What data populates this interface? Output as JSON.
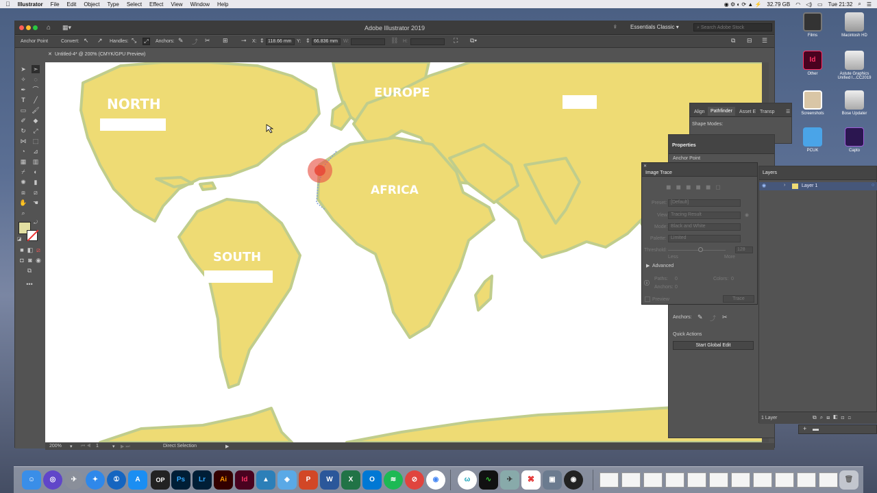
{
  "menubar": {
    "app": "Illustrator",
    "items": [
      "File",
      "Edit",
      "Object",
      "Type",
      "Select",
      "Effect",
      "View",
      "Window",
      "Help"
    ],
    "status": [
      "32.79 GB",
      "Tue 21:32"
    ]
  },
  "window": {
    "title": "Adobe Illustrator 2019",
    "workspace": "Essentials Classic",
    "search_placeholder": "Search Adobe Stock",
    "doc_tab": "Untitled-4* @ 200% (CMYK/GPU Preview)"
  },
  "controlbar": {
    "anchor_point": "Anchor Point",
    "convert": "Convert:",
    "handles": "Handles:",
    "anchors": "Anchors:",
    "x_label": "X:",
    "x_value": "118.66 mm",
    "y_label": "Y:",
    "y_value": "66.836 mm",
    "w_label": "W:",
    "h_label": "H:"
  },
  "statusbar": {
    "zoom": "200%",
    "page": "1",
    "tool": "Direct Selection"
  },
  "pathfinder": {
    "tabs": [
      "Align",
      "Pathfinder",
      "Asset E",
      "Transp"
    ],
    "shape_modes": "Shape Modes:"
  },
  "properties": {
    "title": "Properties",
    "anchor_point": "Anchor Point",
    "anchors_label": "Anchors:",
    "quick_actions": "Quick Actions",
    "start_global_edit": "Start Global Edit"
  },
  "image_trace": {
    "title": "Image Trace",
    "preset_label": "Preset:",
    "preset_value": "[Default]",
    "view_label": "View:",
    "view_value": "Tracing Result",
    "mode_label": "Mode:",
    "mode_value": "Black and White",
    "palette_label": "Palette:",
    "palette_value": "Limited",
    "threshold_label": "Threshold:",
    "threshold_value": "128",
    "less": "Less",
    "more": "More",
    "advanced": "Advanced",
    "paths_label": "Paths:",
    "paths_value": "0",
    "colors_label": "Colors:",
    "colors_value": "0",
    "anchors_label": "Anchors:",
    "anchors_value": "0",
    "preview": "Preview",
    "trace": "Trace"
  },
  "layers": {
    "title": "Layers",
    "layer1": "Layer 1",
    "count": "1 Layer"
  },
  "map_labels": {
    "north": "NORTH",
    "europe": "EUROPE",
    "africa": "AFRICA",
    "south": "SOUTH"
  },
  "desktop_icons": [
    "Films",
    "Macintosh HD",
    "Other",
    "Astute Graphics Unified I...CC2019",
    "Screenshots",
    "Bose Updater",
    "PCUK",
    "Capto"
  ],
  "dock_labels": {
    "op": "OP",
    "ps": "Ps",
    "lr": "Lr",
    "ai": "Ai",
    "id": "Id"
  },
  "colors": {
    "land": "#eedb74",
    "coast": "#bfcc8b",
    "selection": "#e85a48",
    "ui_dark": "#535353"
  }
}
